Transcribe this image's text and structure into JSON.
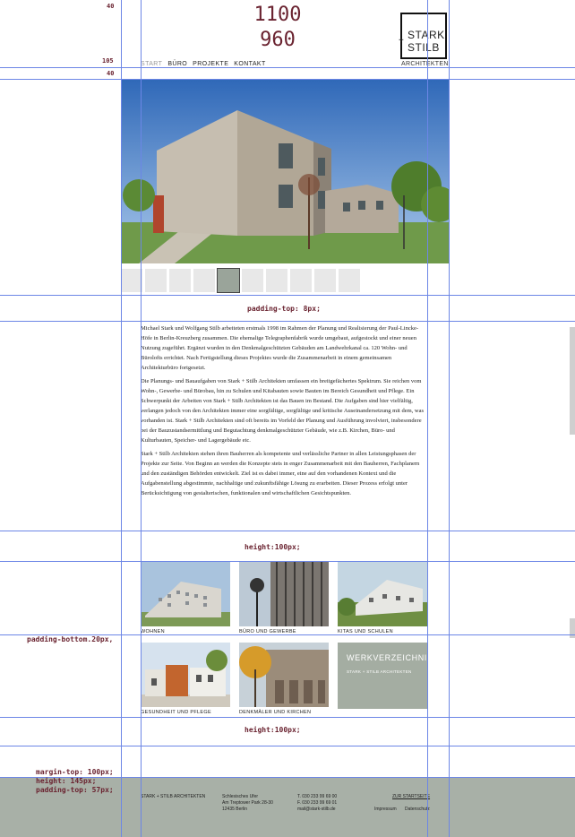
{
  "guides": {
    "left_labels": [
      "40",
      "105",
      "40"
    ]
  },
  "header": {
    "dim_width": "1100",
    "dim_height": "960",
    "logo_line1": "STARK",
    "logo_plus": "+",
    "logo_line2": "STILB",
    "subtitle": "ARCHITEKTEN",
    "nav": [
      "START",
      "BÜRO",
      "PROJEKTE",
      "KONTAKT"
    ]
  },
  "gallery": {
    "thumb_count": 10,
    "active_index": 4
  },
  "notes": {
    "padding_top": "padding-top: 8px;",
    "height_a": "height:100px;",
    "padding_bottom": "padding-bottom.20px,",
    "height_b": "height:100px;",
    "footer_note_1": "margin-top: 100px;",
    "footer_note_2": "height: 145px;",
    "footer_note_3": "padding-top: 57px;"
  },
  "text": {
    "p1": "Michael Stark und Wolfgang Stilb arbeiteten erstmals 1998 im Rahmen der Planung und Realisierung der Paul-Lincke-Höfe in Berlin-Kreuzberg zusammen. Die ehemalige Telegraphenfabrik wurde umgebaut, aufgestockt und einer neuen Nutzung zugeführt. Ergänzt wurden in den Denkmalgeschützten Gebäuden am Landwehrkanal ca. 120 Wohn- und Bürolofts errichtet. Nach Fertigstellung dieses Projektes wurde die Zusammenarbeit in einem gemeinsamen Architekturbüro fortgesetzt.",
    "p2": "Die Planungs- und Bauaufgaben von Stark + Stilb Architekten umfassen ein breitgefächertes Spektrum. Sie reichen vom Wohn-, Gewerbe- und Bürobau, hin zu Schulen und Kitabauten sowie Bauten im Bereich Gesundheit und Pflege. Ein Schwerpunkt der Arbeiten von Stark + Stilb Architekten ist das Bauen im Bestand. Die Aufgaben sind hier vielfältig, verlangen jedoch von den Architekten immer eine sorgfältige, sorgfältige und kritische Auseinandersetzung mit dem, was vorhanden ist. Stark + Stilb Architekten sind oft bereits im Vorfeld der Planung und Ausführung involviert, insbesondere bei der Bauzustandsermittlung und Begutachtung denkmalgeschützter Gebäude, wie z.B. Kirchen, Büro- und Kulturbauten, Speicher- und Lagergebäude etc.",
    "p3": "Stark + Stilb Architekten stehen ihren Bauherren als kompetente und verlässliche Partner in allen Leistungsphasen der Projekte zur Seite. Von Beginn an werden die Konzepte stets in enger Zusammenarbeit mit den Bauherren, Fachplanern und den zuständigen Behörden entwickelt. Ziel ist es dabei immer, eine auf den vorhandenen Kontext und die Aufgabenstellung abgestimmte, nachhaltige und zukunftsfähige Lösung zu erarbeiten. Dieser Prozess erfolgt unter Berücksichtigung von gestalterischen, funktionalen und wirtschaftlichen Gesichtspunkten."
  },
  "projects": [
    {
      "caption": "WOHNEN"
    },
    {
      "caption": "BÜRO UND GEWERBE"
    },
    {
      "caption": "KITAS UND SCHULEN"
    },
    {
      "caption": "GESUNDHEIT UND PFLEGE"
    },
    {
      "caption": "DENKMÄLER UND KIRCHEN"
    }
  ],
  "werk": {
    "title": "WERKVERZEICHNIS",
    "sub": "STARK + STILB ARCHITEKTEN"
  },
  "footer": {
    "company": "STARK + STILB ARCHITEKTEN",
    "addr1": "Schlesisches Ufer",
    "addr2": "Am Treptower Park 28-30",
    "addr3": "12435 Berlin",
    "tel": "T. 030 233 99 69 00",
    "fax": "F. 030 233 99 69 01",
    "mail": "mail@stark-stilb.de",
    "top_link": "ZUR STARTSEITE",
    "impressum": "Impressum",
    "datenschutz": "Datenschutz"
  },
  "colors": {
    "guide": "#6c86e6",
    "annotation": "#6a2330",
    "footer_bg": "#a8b0a7",
    "werk_bg": "#a4ada2"
  }
}
